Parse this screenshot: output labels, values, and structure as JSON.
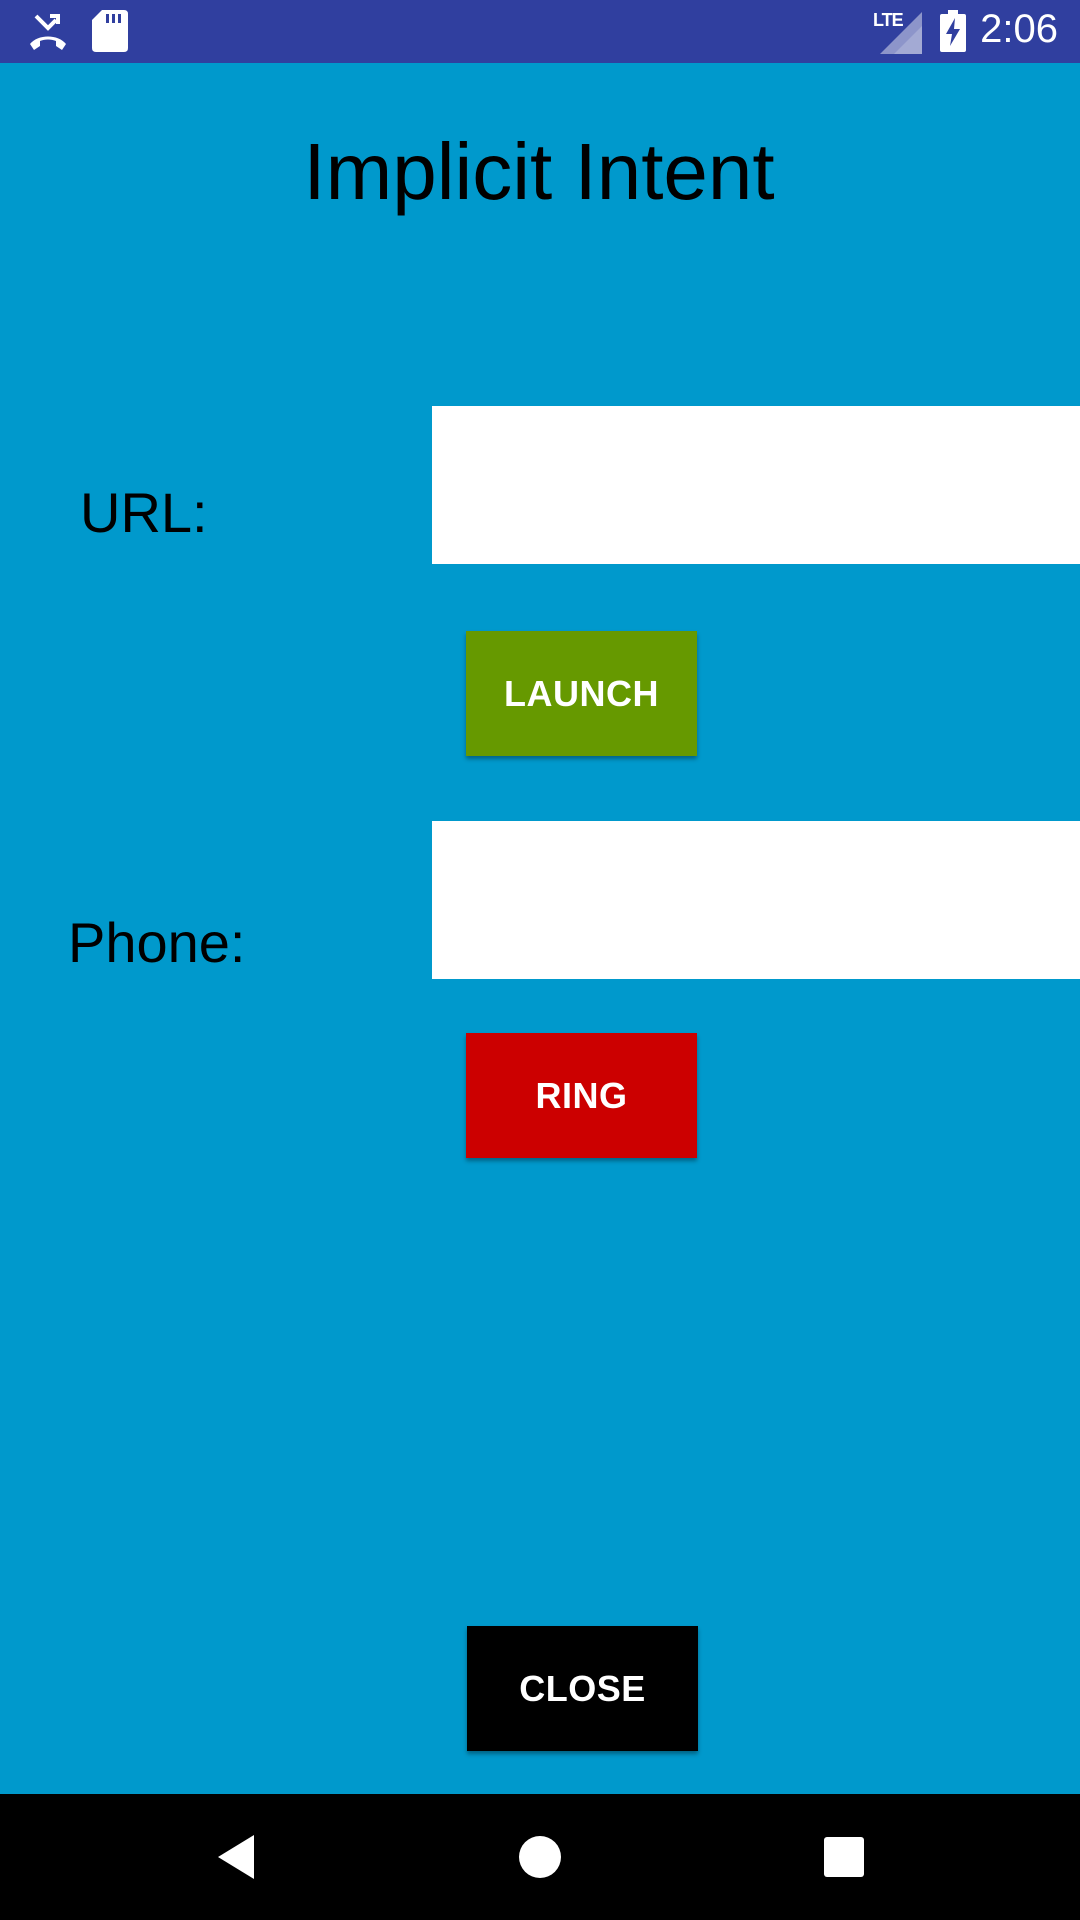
{
  "status_bar": {
    "time": "2:06",
    "network": "LTE",
    "icons": [
      "missed-call-icon",
      "sdcard-icon",
      "signal-icon",
      "battery-charging-icon"
    ]
  },
  "page": {
    "title": "Implicit Intent"
  },
  "url_section": {
    "label": "URL:",
    "value": "",
    "button_label": "LAUNCH"
  },
  "phone_section": {
    "label": "Phone:",
    "value": "",
    "button_label": "RING"
  },
  "close_button_label": "CLOSE",
  "nav_bar": {
    "icons": [
      "back-icon",
      "home-icon",
      "recents-icon"
    ]
  },
  "colors": {
    "background": "#0099cc",
    "status_bar": "#303f9f",
    "launch_button": "#669900",
    "ring_button": "#cc0000",
    "close_button": "#000000"
  }
}
